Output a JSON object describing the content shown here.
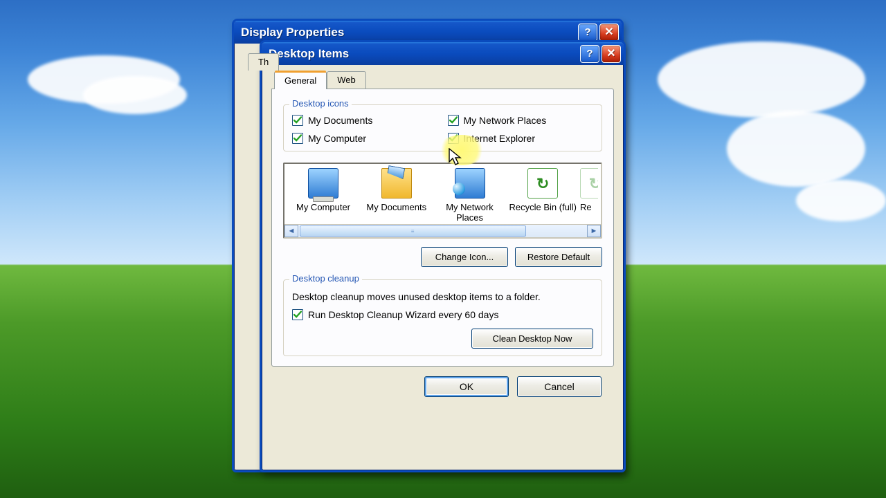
{
  "parent": {
    "title": "Display Properties",
    "tab_cut": "Th"
  },
  "child": {
    "title": "Desktop Items"
  },
  "tabs": {
    "general": "General",
    "web": "Web"
  },
  "icons_group": {
    "legend": "Desktop icons",
    "items": [
      {
        "label": "My Documents",
        "checked": true
      },
      {
        "label": "My Computer",
        "checked": true
      },
      {
        "label": "My Network Places",
        "checked": true
      },
      {
        "label": "Internet Explorer",
        "checked": true
      }
    ]
  },
  "gallery": {
    "items": [
      {
        "label": "My Computer"
      },
      {
        "label": "My Documents"
      },
      {
        "label": "My Network Places"
      },
      {
        "label": "Recycle Bin (full)"
      },
      {
        "label": "Re"
      }
    ]
  },
  "buttons": {
    "change_icon": "Change Icon...",
    "restore_default": "Restore Default",
    "clean_now": "Clean Desktop Now",
    "ok": "OK",
    "cancel": "Cancel"
  },
  "cleanup": {
    "legend": "Desktop cleanup",
    "desc": "Desktop cleanup moves unused desktop items to a folder.",
    "run_label": "Run Desktop Cleanup Wizard every 60 days",
    "run_checked": true
  }
}
